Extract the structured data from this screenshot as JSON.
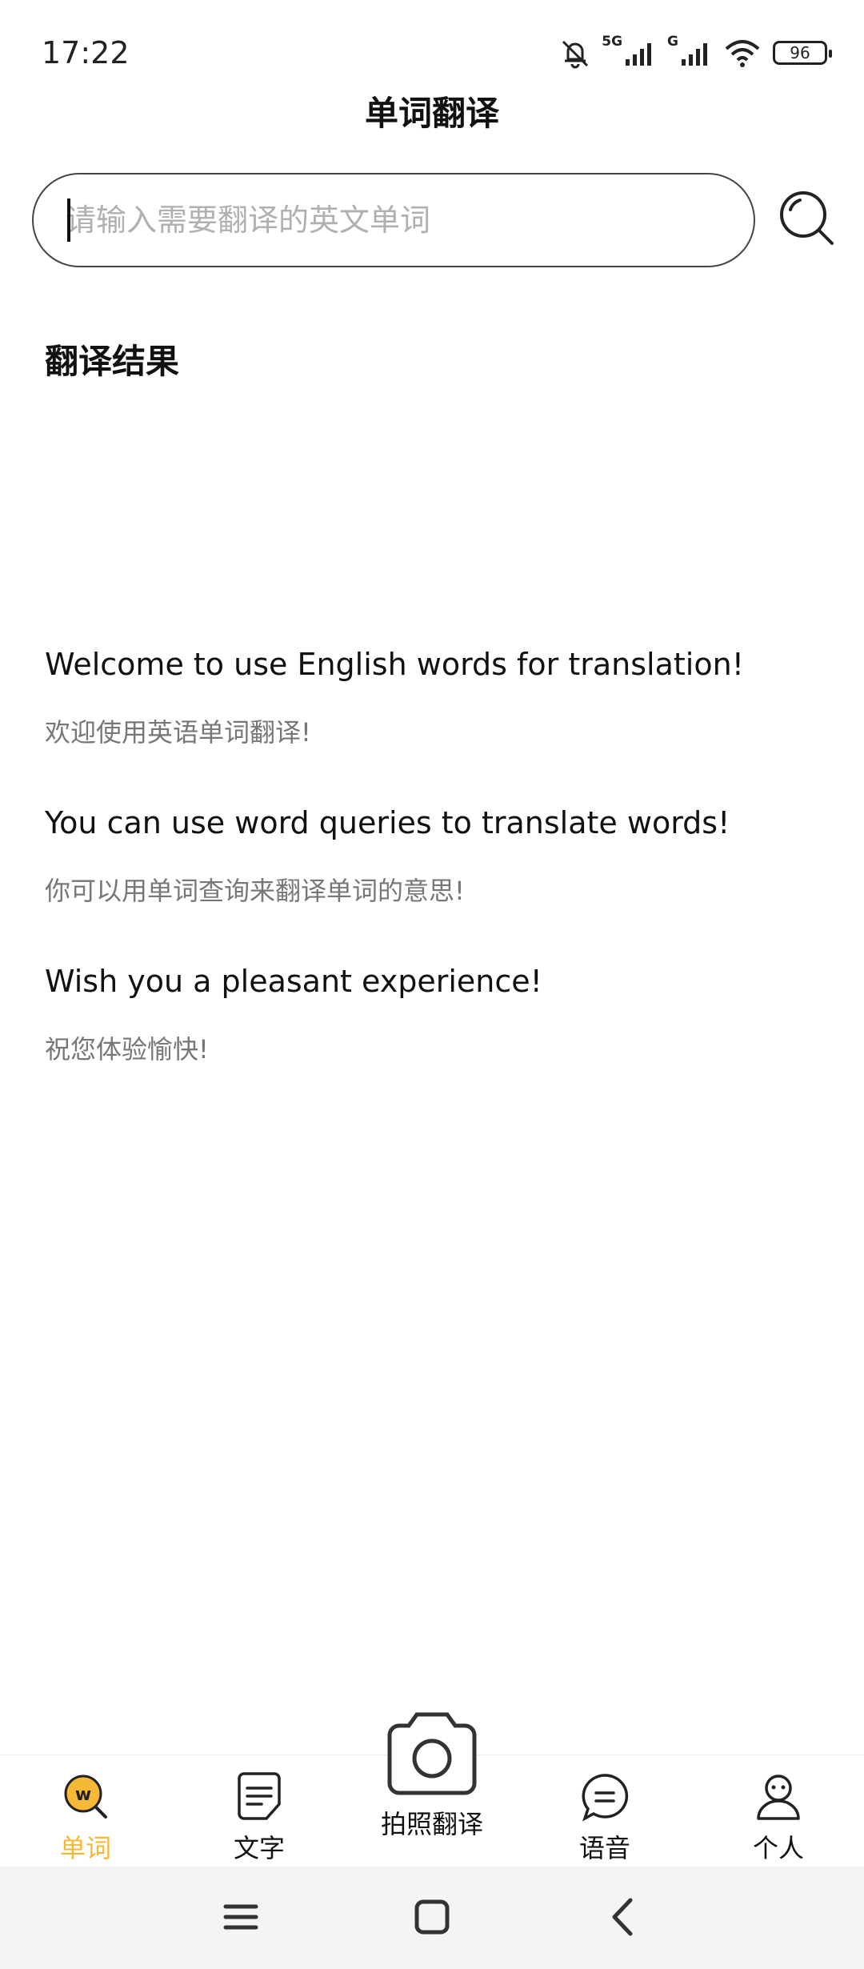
{
  "status_bar": {
    "time": "17:22",
    "signal_label_1": "5G",
    "signal_label_2": "G",
    "battery": "96",
    "icons": [
      "bell-off-icon",
      "signal-icon",
      "signal-icon",
      "wifi-icon",
      "battery-icon"
    ]
  },
  "header": {
    "title": "单词翻译"
  },
  "search": {
    "placeholder": "请输入需要翻译的英文单词",
    "value": "",
    "button_icon": "search-icon"
  },
  "results": {
    "heading": "翻译结果",
    "messages": [
      {
        "en": "Welcome to use English words for translation!",
        "zh": "欢迎使用英语单词翻译!"
      },
      {
        "en": "You can use word queries to translate words!",
        "zh": "你可以用单词查询来翻译单词的意思!"
      },
      {
        "en": "Wish you a pleasant experience!",
        "zh": "祝您体验愉快!"
      }
    ]
  },
  "tab_bar": {
    "accent_color": "#f5b935",
    "tabs": [
      {
        "label": "单词",
        "icon": "word-search-icon",
        "active": true
      },
      {
        "label": "文字",
        "icon": "document-icon",
        "active": false
      },
      {
        "label": "拍照翻译",
        "icon": "camera-icon",
        "active": false
      },
      {
        "label": "语音",
        "icon": "chat-bubble-icon",
        "active": false
      },
      {
        "label": "个人",
        "icon": "person-icon",
        "active": false
      }
    ],
    "word_badge_letter": "w"
  },
  "nav_bar": {
    "icons": [
      "menu-icon",
      "home-icon",
      "back-icon"
    ]
  }
}
